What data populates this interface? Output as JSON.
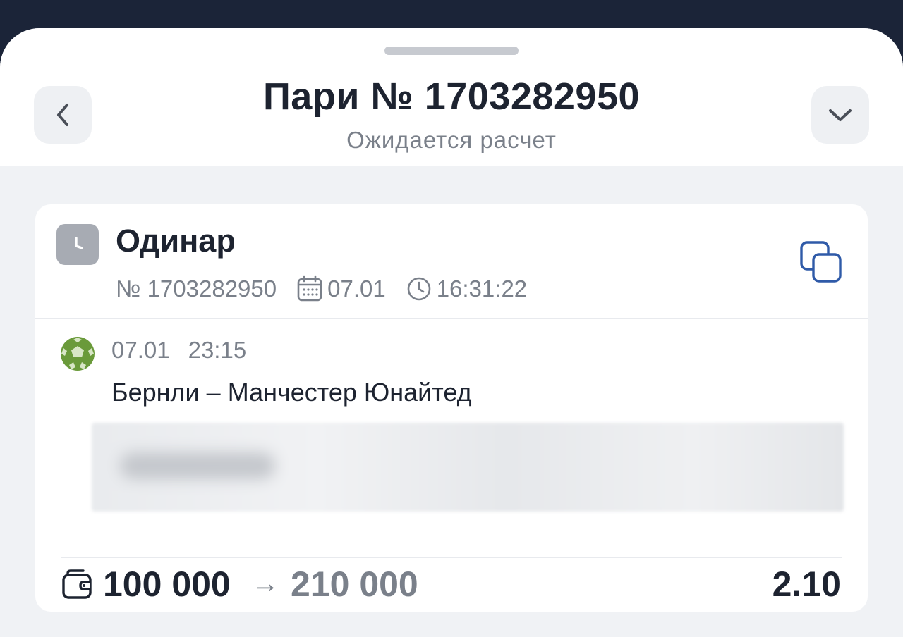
{
  "header": {
    "title": "Пари № 1703282950",
    "subtitle": "Ожидается расчет"
  },
  "bet": {
    "type": "Одинар",
    "number": "№ 1703282950",
    "date": "07.01",
    "time": "16:31:22"
  },
  "event": {
    "date": "07.01",
    "time": "23:15",
    "name": "Бернли – Манчестер Юнайтед"
  },
  "summary": {
    "stake": "100 000",
    "arrow": "→",
    "payout": "210 000",
    "odds": "2.10"
  },
  "icons": {
    "back": "chevron-left-icon",
    "collapse": "chevron-down-icon",
    "bet_type": "clock-icon",
    "date": "calendar-icon",
    "time": "clock-outline-icon",
    "copy": "copy-icon",
    "sport": "football-icon",
    "stake": "wallet-icon"
  },
  "colors": {
    "accent": "#2f5aa8",
    "text": "#1d2330",
    "muted": "#7a808a",
    "sport": "#6a9a3a"
  }
}
